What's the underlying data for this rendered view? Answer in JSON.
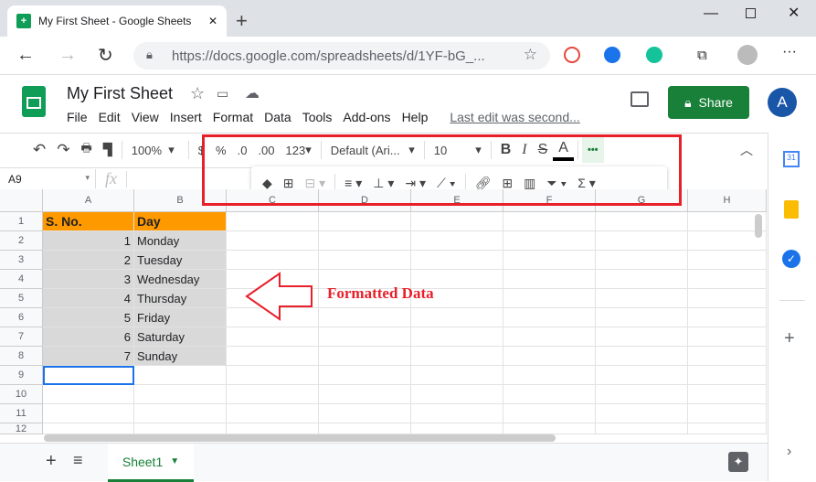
{
  "browser": {
    "tab_title": "My First Sheet - Google Sheets",
    "url": "https://docs.google.com/spreadsheets/d/1YF-bG_..."
  },
  "doc": {
    "title": "My First Sheet",
    "menu": [
      "File",
      "Edit",
      "View",
      "Insert",
      "Format",
      "Data",
      "Tools",
      "Add-ons",
      "Help",
      "Last edit was second..."
    ],
    "share_label": "Share",
    "avatar_initial": "A"
  },
  "toolbar": {
    "zoom": "100%",
    "currency": "$",
    "percent": "%",
    "dec_less": ".0",
    "dec_more": ".00",
    "number_format": "123",
    "font": "Default (Ari...",
    "font_size": "10",
    "bold": "B",
    "italic": "I",
    "strike": "S",
    "text_color": "A",
    "text_color_value": "#000000",
    "more": "•••"
  },
  "formula_bar": {
    "cell_ref": "A9",
    "fx": "fx",
    "value": ""
  },
  "grid": {
    "columns": [
      "A",
      "B",
      "C",
      "D",
      "E",
      "F",
      "G",
      "H"
    ],
    "rows": [
      "1",
      "2",
      "3",
      "4",
      "5",
      "6",
      "7",
      "8",
      "9",
      "10",
      "11",
      "12"
    ],
    "header": [
      "S. No.",
      "Day"
    ],
    "data": [
      [
        "1",
        "Monday"
      ],
      [
        "2",
        "Tuesday"
      ],
      [
        "3",
        "Wednesday"
      ],
      [
        "4",
        "Thursday"
      ],
      [
        "5",
        "Friday"
      ],
      [
        "6",
        "Saturday"
      ],
      [
        "7",
        "Sunday"
      ]
    ],
    "selected_cell": "A9",
    "header_fill": "#ff9900",
    "data_fill": "#d9d9d9"
  },
  "annotation": {
    "text": "Formatted Data",
    "color": "#e8202a"
  },
  "sheets": {
    "add": "+",
    "list": "≡",
    "active": "Sheet1"
  }
}
